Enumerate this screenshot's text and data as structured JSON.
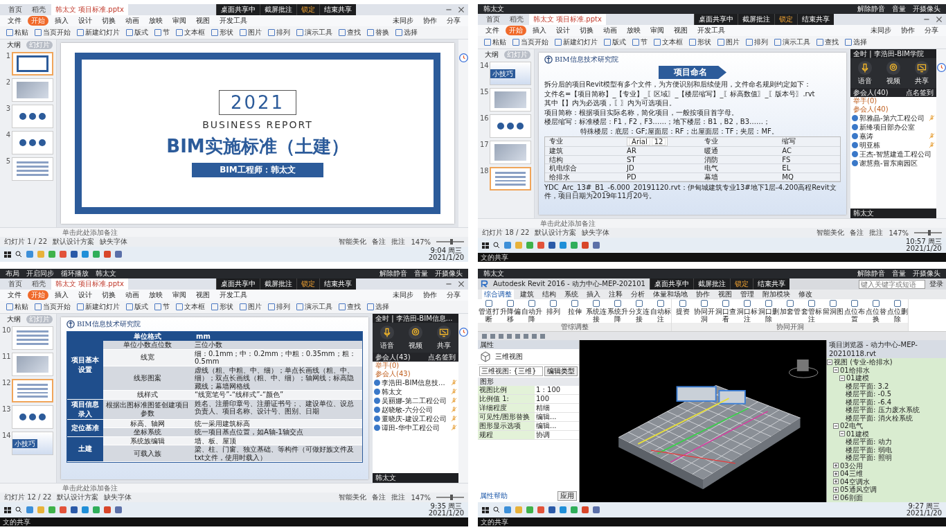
{
  "panels": [
    {
      "share_bar": [
        {
          "label": "桌面共享中",
          "active": false
        },
        {
          "label": "截屏批注",
          "active": false
        },
        {
          "label": "锁定",
          "active": true
        },
        {
          "label": "结束共享",
          "active": false
        }
      ],
      "app": {
        "kind": "wps",
        "tabs": [
          {
            "label": "首页",
            "selected": false
          },
          {
            "label": "稻壳",
            "selected": false
          },
          {
            "label": "韩太文 项目标准.pptx",
            "selected": true
          }
        ],
        "menu": [
          {
            "label": "文件",
            "selected": false
          },
          {
            "label": "开始",
            "selected": true
          },
          {
            "label": "插入",
            "selected": false
          },
          {
            "label": "设计",
            "selected": false
          },
          {
            "label": "切换",
            "selected": false
          },
          {
            "label": "动画",
            "selected": false
          },
          {
            "label": "放映",
            "selected": false
          },
          {
            "label": "审阅",
            "selected": false
          },
          {
            "label": "视图",
            "selected": false
          },
          {
            "label": "开发工具",
            "selected": false
          }
        ],
        "menu_right": [
          "未同步",
          "协作",
          "分享"
        ],
        "toolbar": [
          "粘贴",
          "当页开始",
          "新建幻灯片",
          "版式",
          "节",
          "文本框",
          "形状",
          "图片",
          "排列",
          "演示工具",
          "查找",
          "替换",
          "选择"
        ],
        "sidebar_tabs": [
          {
            "label": "大纲",
            "selected": false
          },
          {
            "label": "幻灯片",
            "selected": true
          }
        ],
        "thumbnails": [
          {
            "number": "1",
            "selected": true,
            "kind": "cover"
          },
          {
            "number": "2",
            "selected": false,
            "kind": "image"
          },
          {
            "number": "3",
            "selected": false,
            "kind": "diagram"
          },
          {
            "number": "4",
            "selected": false,
            "kind": "diagram"
          },
          {
            "number": "5",
            "selected": false,
            "kind": "text"
          }
        ],
        "slide": {
          "kind": "cover",
          "year": "2021",
          "subtitle": "BUSINESS REPORT",
          "title": "BIM实施标准（土建）",
          "author": "BIM工程师：韩太文"
        },
        "notes": "单击此处添加备注",
        "status": [
          "幻灯片 1 / 22",
          "默认设计方案",
          "缺失字体"
        ],
        "zoom_slider": {
          "level": 0.55
        },
        "status_right": [
          "智能美化",
          "备注",
          "批注"
        ],
        "zoom": "147%"
      },
      "taskbar": {
        "time": "9:04 周三",
        "date": "2021/1/20"
      }
    },
    {
      "conference_bar": {
        "left": [
          "韩太文"
        ],
        "right": [
          "解除静音",
          "音量",
          "开摄像头"
        ]
      },
      "share_bar": [
        {
          "label": "桌面共享中",
          "active": false
        },
        {
          "label": "截屏批注",
          "active": false
        },
        {
          "label": "锁定",
          "active": true
        },
        {
          "label": "结束共享",
          "active": false
        }
      ],
      "app": {
        "kind": "wps",
        "tabs": [
          {
            "label": "首页",
            "selected": false
          },
          {
            "label": "稻壳",
            "selected": false
          },
          {
            "label": "韩太文 项目标准.pptx",
            "selected": true
          }
        ],
        "menu": [
          {
            "label": "文件",
            "selected": false
          },
          {
            "label": "开始",
            "selected": true
          },
          {
            "label": "插入",
            "selected": false
          },
          {
            "label": "设计",
            "selected": false
          },
          {
            "label": "切换",
            "selected": false
          },
          {
            "label": "动画",
            "selected": false
          },
          {
            "label": "放映",
            "selected": false
          },
          {
            "label": "审阅",
            "selected": false
          },
          {
            "label": "视图",
            "selected": false
          },
          {
            "label": "开发工具",
            "selected": false
          }
        ],
        "menu_right": [
          "未同步",
          "协作",
          "分享"
        ],
        "toolbar": [
          "粘贴",
          "当页开始",
          "新建幻灯片",
          "版式",
          "节",
          "文本框",
          "形状",
          "图片",
          "排列",
          "演示工具",
          "查找",
          "选择"
        ],
        "sidebar_tabs": [
          {
            "label": "大纲",
            "selected": false
          },
          {
            "label": "幻灯片",
            "selected": true
          }
        ],
        "thumbnails": [
          {
            "number": "14",
            "selected": false,
            "kind": "tip",
            "label": "小技巧"
          },
          {
            "number": "15",
            "selected": false,
            "kind": "image"
          },
          {
            "number": "16",
            "selected": false,
            "kind": "diagram"
          },
          {
            "number": "17",
            "selected": false,
            "kind": "image"
          },
          {
            "number": "18",
            "selected": true,
            "kind": "text"
          }
        ],
        "slide": {
          "kind": "naming",
          "org": "BIM信息技术研究院",
          "heading": "项目命名",
          "paragraphs": [
            {
              "text": "拆分后的项目Revit模型有多个文件，为方便识别和后续使用，文件命名规则约定如下：",
              "indented": false
            },
            {
              "text": "文件名=【项目简称】_【专业】_〖区域〗_【楼层缩写】_〖标高数值〗_〖版本号〗.rvt",
              "indented": false
            },
            {
              "text": "其中【】内为必选项，〖〗内为可选项目。",
              "indented": false
            },
            {
              "text": "项目简称：根据项目实际名称，简化项目，一般按项目首字母。",
              "indented": false
            },
            {
              "text": "楼层缩写：标准楼层：F1，F2，F3……；地下楼层：B1，B2，B3……；",
              "indented": false
            },
            {
              "text": "特殊楼层：底层：GF;屋面层：RF；出屋面层：TF；夹层：MF。",
              "indented": true
            }
          ],
          "mini_toolbar": {
            "font": "Arial",
            "size": "12"
          },
          "table_header": [
            "专业",
            "专业",
            "缩写"
          ],
          "table_rows": [
            [
              "建筑",
              "AR",
              "暖通",
              "AC"
            ],
            [
              "结构",
              "ST",
              "消防",
              "FS"
            ],
            [
              "机电综合",
              "JD",
              "电气",
              "EL"
            ],
            [
              "给排水",
              "PD",
              "幕墙",
              "MQ"
            ]
          ],
          "footer": "YDC_Arc_13#_B1_-6.000_20191120.rvt：伊甸城建筑专业13#地下1层-4.200高程Revit文件，项目日期为2019年11月20号。"
        },
        "notes": "单击此处添加备注",
        "status": [
          "幻灯片 18 / 22",
          "默认设计方案",
          "缺失字体"
        ],
        "zoom_slider": {
          "level": 0.55
        },
        "status_right": [
          "智能美化",
          "备注",
          "批注"
        ],
        "zoom": "147%"
      },
      "meeting": {
        "title": "全时 | 李浩田-BIM学院",
        "buttons": [
          {
            "label": "语音",
            "kind": "mic"
          },
          {
            "label": "视频",
            "kind": "camera"
          },
          {
            "label": "共享",
            "kind": "screen"
          }
        ],
        "attendees": "参会人(40)",
        "roll_call": "点名签到",
        "hands": "举手(0)",
        "group": "参会人(40)",
        "participants": [
          {
            "name": "郭雅晶-第六工程公司",
            "muted": true
          },
          {
            "name": "新绛项目部办公室",
            "muted": false
          },
          {
            "name": "嘉涛",
            "muted": true
          },
          {
            "name": "明亚栋",
            "muted": true
          },
          {
            "name": "王杰-智慧建造工程公司",
            "muted": false
          },
          {
            "name": "谢慧燕-冒东南园区",
            "muted": false
          }
        ],
        "self": "韩太文"
      },
      "taskbar": {
        "time": "10:57 周三",
        "date": "2021/1/20"
      },
      "footer_caption": "文的共享"
    },
    {
      "conference_bar": {
        "left": [
          "布局",
          "开启同步",
          "循环播放",
          "韩太文"
        ],
        "right": [
          "解除静音",
          "音量",
          "开摄像头"
        ]
      },
      "share_bar": [
        {
          "label": "桌面共享中",
          "active": false
        },
        {
          "label": "截屏批注",
          "active": false
        },
        {
          "label": "锁定",
          "active": true
        },
        {
          "label": "结束共享",
          "active": false
        }
      ],
      "app": {
        "kind": "wps",
        "tabs": [
          {
            "label": "首页",
            "selected": false
          },
          {
            "label": "稻壳",
            "selected": false
          },
          {
            "label": "韩太文 项目标准.pptx",
            "selected": true
          }
        ],
        "menu": [
          {
            "label": "文件",
            "selected": false
          },
          {
            "label": "开始",
            "selected": true
          },
          {
            "label": "插入",
            "selected": false
          },
          {
            "label": "设计",
            "selected": false
          },
          {
            "label": "切换",
            "selected": false
          },
          {
            "label": "动画",
            "selected": false
          },
          {
            "label": "放映",
            "selected": false
          },
          {
            "label": "审阅",
            "selected": false
          },
          {
            "label": "视图",
            "selected": false
          },
          {
            "label": "开发工具",
            "selected": false
          }
        ],
        "menu_right": [
          "未同步",
          "协作",
          "分享"
        ],
        "toolbar": [
          "粘贴",
          "当页开始",
          "新建幻灯片",
          "版式",
          "节",
          "文本框",
          "形状",
          "图片",
          "排列",
          "演示工具",
          "查找",
          "选择"
        ],
        "sidebar_tabs": [
          {
            "label": "大纲",
            "selected": false
          },
          {
            "label": "幻灯片",
            "selected": true
          }
        ],
        "thumbnails": [
          {
            "number": "10",
            "selected": false,
            "kind": "text"
          },
          {
            "number": "11",
            "selected": false,
            "kind": "image"
          },
          {
            "number": "12",
            "selected": true,
            "kind": "text"
          },
          {
            "number": "13",
            "selected": false,
            "kind": "diagram"
          },
          {
            "number": "14",
            "selected": false,
            "kind": "tip",
            "label": "小技巧"
          }
        ],
        "slide": {
          "kind": "table",
          "org": "BIM信息技术研究院",
          "header": [
            "单位格式",
            "mm"
          ],
          "groups": [
            {
              "label": "项目基本设置",
              "rows": [
                [
                  "单位小数点位数",
                  "三位小数"
                ],
                [
                  "线宽",
                  "细：0.1mm；中：0.2mm；中粗：0.35mm；粗：0.5mm"
                ],
                [
                  "线形图案",
                  "虚线（粗、中粗、中、细）；单点长画线（粗、中、细）；双点长画线（粗、中、细）；轴网线；标高隐藏线；幕墙网格线"
                ],
                [
                  "线样式",
                  "“线宽笔号”-“线样式”-“颜色”"
                ]
              ]
            },
            {
              "label": "项目信息录入",
              "rows": [
                [
                  "根据出图标准图签创建项目参数",
                  "姓名、注册印章号、注册证书号；、建设单位、设总负责人、项目名称、设计号、图别、日期"
                ]
              ]
            },
            {
              "label": "定位基准",
              "rows": [
                [
                  "标高、轴网",
                  "统一采用建筑标高"
                ],
                [
                  "坐标系统",
                  "统一项目基点位置，如A轴-1轴交点"
                ]
              ]
            },
            {
              "label": "土建",
              "rows": [
                [
                  "系统族编辑",
                  "墙、板、屋顶"
                ],
                [
                  "可载入族",
                  "梁、柱、门窗、独立基础、等构件（可做好族文件及txt文件，使用时载入）"
                ]
              ]
            }
          ]
        },
        "notes": "单击此处添加备注",
        "status": [
          "幻灯片 12 / 22",
          "默认设计方案",
          "缺失字体"
        ],
        "zoom_slider": {
          "level": 0.55
        },
        "status_right": [
          "智能美化",
          "备注",
          "批注"
        ],
        "zoom": "147%"
      },
      "meeting": {
        "title": "全时 | 李浩田-BIM信息...",
        "buttons": [
          {
            "label": "语音",
            "kind": "mic"
          },
          {
            "label": "视频",
            "kind": "camera"
          },
          {
            "label": "共享",
            "kind": "screen"
          }
        ],
        "attendees": "参会人(43)",
        "roll_call": "点名签到",
        "hands": "举手(0)",
        "group": "参会人(43)",
        "participants": [
          {
            "name": "李浩田-BIM信息技...",
            "muted": true
          },
          {
            "name": "韩太文",
            "muted": true
          },
          {
            "name": "吴丽娜-第二工程公司",
            "muted": true
          },
          {
            "name": "赵晓敏-六分公司",
            "muted": true
          },
          {
            "name": "董晓庆-建设工程公司",
            "muted": true
          },
          {
            "name": "谭田-华中工程公司",
            "muted": true
          }
        ],
        "self": "韩太文"
      },
      "taskbar": {
        "time": "9:35 周三",
        "date": "2021/1/20"
      },
      "footer_caption": "文的共享"
    },
    {
      "conference_bar": {
        "left": [
          "韩太文"
        ],
        "right": [
          "解除静音",
          "音量",
          "开摄像头"
        ]
      },
      "share_bar": [
        {
          "label": "桌面共享中",
          "active": false
        },
        {
          "label": "截屏批注",
          "active": false
        },
        {
          "label": "锁定",
          "active": true
        },
        {
          "label": "结束共享",
          "active": false
        }
      ],
      "app": {
        "kind": "revit",
        "title": "Autodesk Revit 2016 - 动力中心-MEP-202101",
        "search_placeholder": "键入关键字或短语",
        "user": "登录",
        "ribbon_tabs": [
          {
            "label": "综合调整",
            "selected": true
          },
          {
            "label": "建筑",
            "selected": false
          },
          {
            "label": "结构",
            "selected": false
          },
          {
            "label": "系统",
            "selected": false
          },
          {
            "label": "插入",
            "selected": false
          },
          {
            "label": "注释",
            "selected": false
          },
          {
            "label": "分析",
            "selected": false
          },
          {
            "label": "体量和场地",
            "selected": false
          },
          {
            "label": "协作",
            "selected": false
          },
          {
            "label": "视图",
            "selected": false
          },
          {
            "label": "管理",
            "selected": false
          },
          {
            "label": "附加模块",
            "selected": false
          },
          {
            "label": "修改",
            "selected": false
          }
        ],
        "tool_groups": [
          {
            "label": "管综调整",
            "tools": [
              "管道打断",
              "升降偏移",
              "自动升降",
              "排列",
              "拉伸",
              "系统连接",
              "系统升降",
              "分支连接",
              "自动标注"
            ]
          },
          {
            "label": "协同开洞",
            "tools": [
              "提资",
              "协同开洞",
              "洞口查看",
              "洞口标注",
              "洞口删除",
              "加套管",
              "套管标注",
              "留洞图",
              "点位布置",
              "点位替换",
              "点位删除"
            ]
          }
        ],
        "properties": {
          "title": "属性",
          "type": "三维视图",
          "selector": "三维视图: {三维}",
          "edit_type": "编辑类型",
          "section": "图形",
          "rows": [
            [
              "视图比例",
              "1 : 100"
            ],
            [
              "比例值 1:",
              "100"
            ],
            [
              "详细程度",
              "精细"
            ],
            [
              "可见性/图形替换",
              "编辑..."
            ],
            [
              "图形显示选项",
              "编辑..."
            ],
            [
              "规程",
              "协调"
            ]
          ],
          "help": "属性帮助",
          "apply": "应用"
        },
        "browser": {
          "title": "项目浏览器 - 动力中心-MEP-20210118.rvt",
          "tree": [
            {
              "label": "视图 (专业-给排水)",
              "expanded": true,
              "children": [
                {
                  "label": "01给排水",
                  "expanded": true,
                  "children": [
                    {
                      "label": "01建模",
                      "expanded": true,
                      "children": [
                        {
                          "label": "楼层平面: 3.2"
                        },
                        {
                          "label": "楼层平面: -0.5"
                        },
                        {
                          "label": "楼层平面: -6.4"
                        },
                        {
                          "label": "楼层平面: 压力废水系统"
                        },
                        {
                          "label": "楼层平面: 消火栓系统"
                        }
                      ]
                    }
                  ]
                },
                {
                  "label": "02电气",
                  "expanded": true,
                  "children": [
                    {
                      "label": "01建模",
                      "expanded": true,
                      "children": [
                        {
                          "label": "楼层平面: 动力"
                        },
                        {
                          "label": "楼层平面: 弱电"
                        },
                        {
                          "label": "楼层平面: 照明"
                        }
                      ]
                    }
                  ]
                },
                {
                  "label": "03公用",
                  "expanded": false
                },
                {
                  "label": "04三维",
                  "expanded": false
                },
                {
                  "label": "04空调水",
                  "expanded": false
                },
                {
                  "label": "05通风空调",
                  "expanded": false
                },
                {
                  "label": "06剖面",
                  "expanded": false
                }
              ]
            }
          ]
        }
      },
      "taskbar": {
        "time": "9:27 周三",
        "date": "2021/1/20"
      },
      "footer_caption": "文的共享"
    }
  ]
}
